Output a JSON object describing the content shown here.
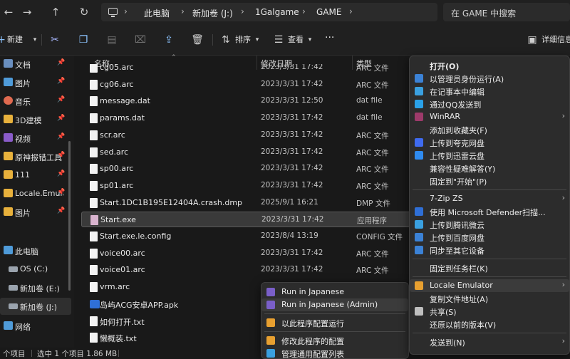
{
  "nav": {
    "back_glyph": "←",
    "forward_glyph": "→",
    "up_glyph": "↑",
    "refresh_glyph": "↻"
  },
  "breadcrumb": {
    "items": [
      "此电脑",
      "新加卷 (J:)",
      "1Galgame",
      "GAME"
    ],
    "separator": "›"
  },
  "search": {
    "placeholder": "在 GAME 中搜索"
  },
  "toolbar": {
    "new_label": "新建",
    "sort_label": "排序",
    "view_label": "查看",
    "more_label": "···",
    "details_label": "详细信息"
  },
  "sidebar": {
    "items": [
      {
        "label": "文档",
        "pinned": true,
        "icon": "document-icon",
        "color": "#6a8fbf"
      },
      {
        "label": "图片",
        "pinned": true,
        "icon": "pictures-icon",
        "color": "#4f9bd9"
      },
      {
        "label": "音乐",
        "pinned": true,
        "icon": "music-icon",
        "color": "#e06a50"
      },
      {
        "label": "3D建模",
        "pinned": true,
        "icon": "folder-icon",
        "color": "#e8b13c"
      },
      {
        "label": "视频",
        "pinned": true,
        "icon": "video-icon",
        "color": "#8a5cc9"
      },
      {
        "label": "原神报错工具",
        "pinned": true,
        "icon": "folder-icon",
        "color": "#e8b13c"
      },
      {
        "label": "111",
        "pinned": true,
        "icon": "folder-icon",
        "color": "#e8b13c"
      },
      {
        "label": "Locale.Emulator",
        "pinned": true,
        "icon": "folder-icon",
        "color": "#e8b13c"
      },
      {
        "label": "图片",
        "pinned": true,
        "icon": "folder-icon",
        "color": "#e8b13c"
      },
      {
        "label": "此电脑",
        "pinned": false,
        "icon": "pc-icon",
        "color": "#4f9bd9"
      },
      {
        "label": "OS (C:)",
        "pinned": false,
        "icon": "drive-icon",
        "color": "#9aa3ad"
      },
      {
        "label": "新加卷 (E:)",
        "pinned": false,
        "icon": "drive-icon",
        "color": "#9aa3ad"
      },
      {
        "label": "新加卷 (J:)",
        "pinned": false,
        "icon": "drive-icon",
        "color": "#9aa3ad"
      },
      {
        "label": "网络",
        "pinned": false,
        "icon": "network-icon",
        "color": "#4f9bd9"
      }
    ]
  },
  "columns": {
    "name": "名称",
    "date": "修改日期",
    "type": "类型"
  },
  "files": [
    {
      "name": "cg05.arc",
      "date": "2023/3/31 17:42",
      "type": "ARC 文件",
      "kind": "doc"
    },
    {
      "name": "cg06.arc",
      "date": "2023/3/31 17:42",
      "type": "ARC 文件",
      "kind": "doc"
    },
    {
      "name": "message.dat",
      "date": "2023/3/31 12:50",
      "type": "dat file",
      "kind": "doc"
    },
    {
      "name": "params.dat",
      "date": "2023/3/31 17:42",
      "type": "dat file",
      "kind": "doc"
    },
    {
      "name": "scr.arc",
      "date": "2023/3/31 17:42",
      "type": "ARC 文件",
      "kind": "doc"
    },
    {
      "name": "sed.arc",
      "date": "2023/3/31 17:42",
      "type": "ARC 文件",
      "kind": "doc"
    },
    {
      "name": "sp00.arc",
      "date": "2023/3/31 17:42",
      "type": "ARC 文件",
      "kind": "doc"
    },
    {
      "name": "sp01.arc",
      "date": "2023/3/31 17:42",
      "type": "ARC 文件",
      "kind": "doc"
    },
    {
      "name": "Start.1DC1B195E12404A.crash.dmp",
      "date": "2025/9/1 16:21",
      "type": "DMP 文件",
      "kind": "doc"
    },
    {
      "name": "Start.exe",
      "date": "2023/3/31 17:42",
      "type": "应用程序",
      "kind": "app",
      "selected": true
    },
    {
      "name": "Start.exe.le.config",
      "date": "2023/8/4 13:19",
      "type": "CONFIG 文件",
      "kind": "doc"
    },
    {
      "name": "voice00.arc",
      "date": "2023/3/31 17:42",
      "type": "ARC 文件",
      "kind": "doc"
    },
    {
      "name": "voice01.arc",
      "date": "2023/3/31 17:42",
      "type": "ARC 文件",
      "kind": "doc"
    },
    {
      "name": "vrm.arc",
      "date": "",
      "type": "",
      "kind": "doc"
    },
    {
      "name": "岛屿ACG安卓APP.apk",
      "date": "",
      "type": "",
      "kind": "apk"
    },
    {
      "name": "如何打开.txt",
      "date": "",
      "type": "",
      "kind": "doc"
    },
    {
      "name": "懒概装.txt",
      "date": "",
      "type": "",
      "kind": "doc"
    }
  ],
  "status": {
    "count": "个项目",
    "selection": "选中 1 个项目  1.86 MB"
  },
  "context_menu": {
    "items": [
      {
        "label": "打开(O)",
        "bold": true,
        "icon": "",
        "color": ""
      },
      {
        "label": "以管理员身份运行(A)",
        "icon": "shield-icon",
        "color": "#3b82d6"
      },
      {
        "label": "在记事本中编辑",
        "icon": "notepad-icon",
        "color": "#3aa0e0"
      },
      {
        "label": "通过QQ发送到",
        "icon": "qq-icon",
        "color": "#2aa1e8"
      },
      {
        "label": "WinRAR",
        "icon": "winrar-icon",
        "color": "#9d3a6a",
        "submenu": true
      },
      {
        "label": "添加到收藏夹(F)",
        "icon": "",
        "color": ""
      },
      {
        "label": "上传到夸克网盘",
        "icon": "quark-icon",
        "color": "#3f6bf0"
      },
      {
        "label": "上传到迅雷云盘",
        "icon": "thunder-icon",
        "color": "#2f8bf0"
      },
      {
        "label": "兼容性疑难解答(Y)",
        "icon": "",
        "color": ""
      },
      {
        "label": "固定到\"开始\"(P)",
        "icon": "",
        "color": ""
      },
      {
        "label": "7-Zip ZS",
        "icon": "",
        "color": "",
        "submenu": true
      },
      {
        "label": "使用 Microsoft Defender扫描...",
        "icon": "defender-icon",
        "color": "#2f6fd6"
      },
      {
        "label": "上传到腾讯微云",
        "icon": "weiyun-icon",
        "color": "#3aa0e0"
      },
      {
        "label": "上传到百度网盘",
        "icon": "baidu-icon",
        "color": "#3b82d6"
      },
      {
        "label": "同步至其它设备",
        "icon": "sync-icon",
        "color": "#3b82d6"
      },
      {
        "label": "固定到任务栏(K)",
        "icon": "",
        "color": ""
      },
      {
        "label": "Locale Emulator",
        "icon": "locale-emulator-icon",
        "color": "#e8a030",
        "submenu": true,
        "highlight": true
      },
      {
        "label": "复制文件地址(A)",
        "icon": "",
        "color": ""
      },
      {
        "label": "共享(S)",
        "icon": "share-icon",
        "color": "#bfbfbf"
      },
      {
        "label": "还原以前的版本(V)",
        "icon": "",
        "color": ""
      },
      {
        "label": "发送到(N)",
        "icon": "",
        "color": "",
        "submenu": true
      }
    ]
  },
  "submenu": {
    "items": [
      {
        "label": "Run in Japanese",
        "icon": "le-run-icon",
        "color": "#7a5fc9"
      },
      {
        "label": "Run in Japanese (Admin)",
        "icon": "le-admin-icon",
        "color": "#7a5fc9",
        "highlight": true
      },
      {
        "label": "以此程序配置运行",
        "icon": "le-config-icon",
        "color": "#e8a030"
      },
      {
        "label": "修改此程序的配置",
        "icon": "le-edit-icon",
        "color": "#e8a030"
      },
      {
        "label": "管理通用配置列表",
        "icon": "le-manage-icon",
        "color": "#3aa0e0"
      }
    ]
  }
}
